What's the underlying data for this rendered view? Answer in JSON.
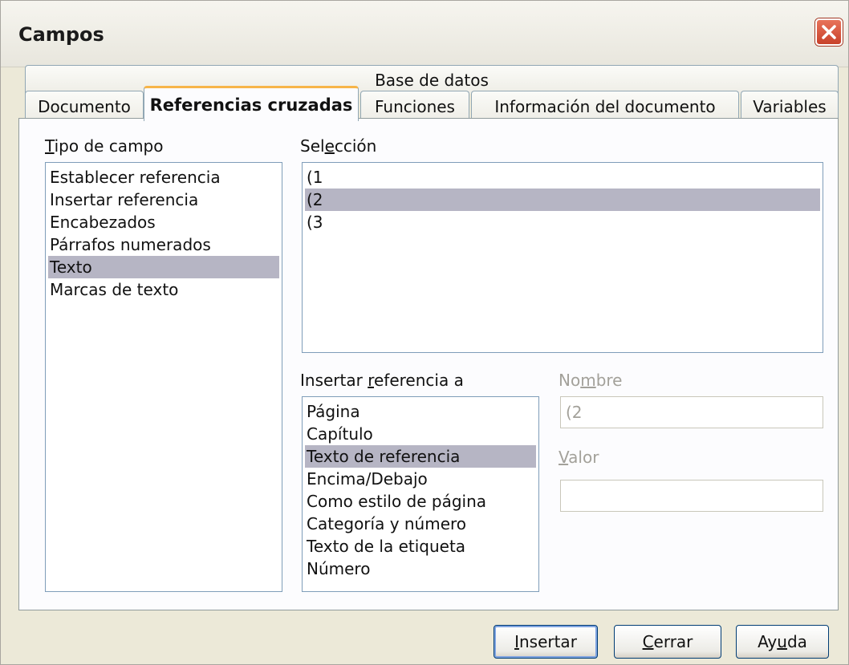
{
  "window": {
    "title": "Campos"
  },
  "tabs": {
    "row_top": [
      "Base de datos"
    ],
    "row_bottom": [
      "Documento",
      "Referencias cruzadas",
      "Funciones",
      "Información del documento",
      "Variables"
    ],
    "active": "Referencias cruzadas"
  },
  "field_type": {
    "label": "Tipo de campo",
    "label_mnemonic": "T",
    "items": [
      "Establecer referencia",
      "Insertar referencia",
      "Encabezados",
      "Párrafos numerados",
      "Texto",
      "Marcas de texto"
    ],
    "selected": "Texto"
  },
  "selection": {
    "label_pre": "Sel",
    "label_mnemonic": "e",
    "label_post": "cción",
    "items": [
      "(1",
      "(2",
      "(3"
    ],
    "selected": "(2"
  },
  "insert_ref": {
    "label_pre": "Insertar ",
    "label_mnemonic": "r",
    "label_post": "eferencia a",
    "items": [
      "Página",
      "Capítulo",
      "Texto de referencia",
      "Encima/Debajo",
      "Como estilo de página",
      "Categoría y número",
      "Texto de la etiqueta",
      "Número"
    ],
    "selected": "Texto de referencia"
  },
  "name_field": {
    "label_pre": "No",
    "label_mnemonic": "m",
    "label_post": "bre",
    "value": "(2"
  },
  "value_field": {
    "label_mnemonic": "V",
    "label_post": "alor",
    "value": ""
  },
  "buttons": {
    "insert": {
      "mnemonic": "I",
      "rest": "nsertar"
    },
    "close": {
      "mnemonic": "C",
      "rest": "errar"
    },
    "help": {
      "pre": "Ay",
      "mnemonic": "u",
      "post": "da"
    }
  },
  "colors": {
    "selection_highlight": "#b6b5c4",
    "active_tab_accent": "#f7b549",
    "close_button": "#c8412a"
  }
}
